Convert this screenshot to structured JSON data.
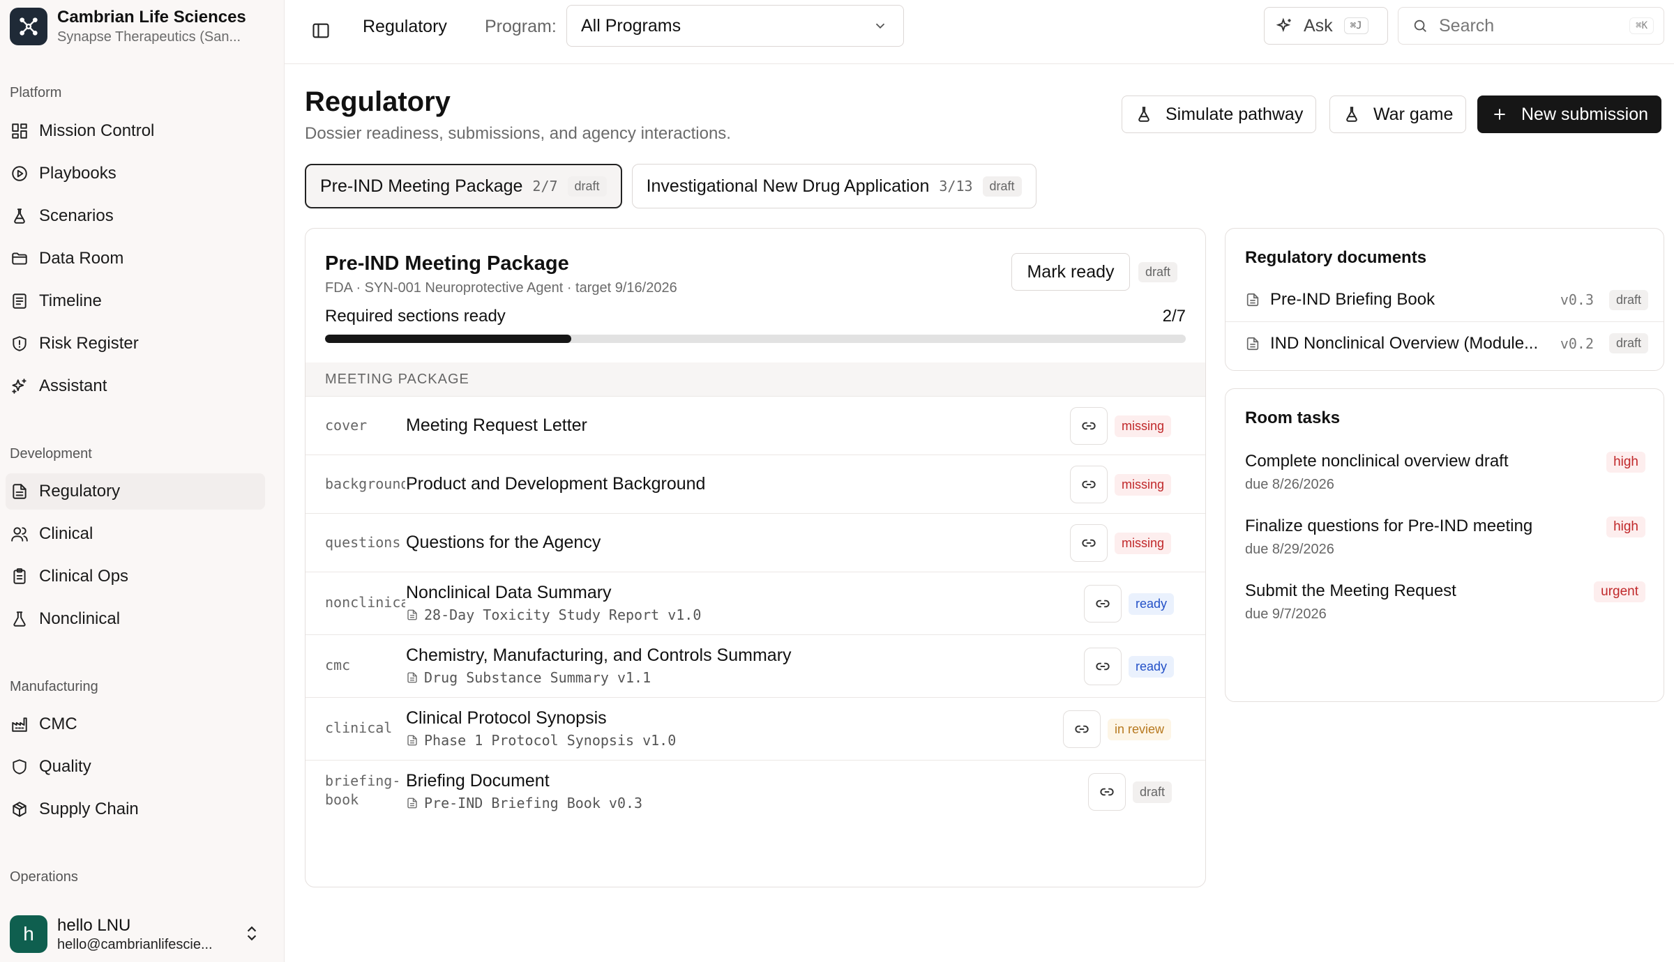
{
  "org": {
    "name": "Cambrian Life Sciences",
    "subtitle": "Synapse Therapeutics (San..."
  },
  "sidebar": {
    "sections": [
      {
        "label": "Platform"
      },
      {
        "label": "Development"
      },
      {
        "label": "Manufacturing"
      },
      {
        "label": "Operations"
      }
    ],
    "items": [
      {
        "label": "Mission Control",
        "icon": "dashboard-icon"
      },
      {
        "label": "Playbooks",
        "icon": "play-circle-icon"
      },
      {
        "label": "Scenarios",
        "icon": "flask-icon"
      },
      {
        "label": "Data Room",
        "icon": "folder-icon"
      },
      {
        "label": "Timeline",
        "icon": "list-icon"
      },
      {
        "label": "Risk Register",
        "icon": "shield-alert-icon"
      },
      {
        "label": "Assistant",
        "icon": "sparkles-icon"
      },
      {
        "label": "Regulatory",
        "icon": "file-text-icon",
        "active": true
      },
      {
        "label": "Clinical",
        "icon": "users-icon"
      },
      {
        "label": "Clinical Ops",
        "icon": "clipboard-icon"
      },
      {
        "label": "Nonclinical",
        "icon": "beaker-icon"
      },
      {
        "label": "CMC",
        "icon": "factory-icon"
      },
      {
        "label": "Quality",
        "icon": "shield-icon"
      },
      {
        "label": "Supply Chain",
        "icon": "package-icon"
      }
    ]
  },
  "user": {
    "initial": "h",
    "name": "hello LNU",
    "email": "hello@cambrianlifescie..."
  },
  "topbar": {
    "breadcrumb": "Regulatory",
    "program_label": "Program:",
    "program_value": "All Programs",
    "ask_label": "Ask",
    "ask_shortcut": "⌘J",
    "search_placeholder": "Search",
    "search_shortcut": "⌘K"
  },
  "page": {
    "title": "Regulatory",
    "subtitle": "Dossier readiness, submissions, and agency interactions.",
    "buttons": {
      "simulate": "Simulate pathway",
      "wargame": "War game",
      "new_submission": "New submission"
    }
  },
  "tabs": [
    {
      "label": "Pre-IND Meeting Package",
      "count": "2/7",
      "status": "draft",
      "active": true
    },
    {
      "label": "Investigational New Drug Application",
      "count": "3/13",
      "status": "draft"
    }
  ],
  "package": {
    "title": "Pre-IND Meeting Package",
    "meta": "FDA · SYN-001 Neuroprotective Agent · target 9/16/2026",
    "mark_ready_label": "Mark ready",
    "status": "draft",
    "progress_label": "Required sections ready",
    "progress_count": "2/7",
    "progress_fraction": 0.286,
    "section_heading": "MEETING PACKAGE",
    "rows": [
      {
        "key": "cover",
        "title": "Meeting Request Letter",
        "doc": "",
        "status": "missing"
      },
      {
        "key": "background",
        "title": "Product and Development Background",
        "doc": "",
        "status": "missing"
      },
      {
        "key": "questions",
        "title": "Questions for the Agency",
        "doc": "",
        "status": "missing"
      },
      {
        "key": "nonclinical",
        "title": "Nonclinical Data Summary",
        "doc": "28-Day Toxicity Study Report v1.0",
        "status": "ready"
      },
      {
        "key": "cmc",
        "title": "Chemistry, Manufacturing, and Controls Summary",
        "doc": "Drug Substance Summary v1.1",
        "status": "ready"
      },
      {
        "key": "clinical",
        "title": "Clinical Protocol Synopsis",
        "doc": "Phase 1 Protocol Synopsis v1.0",
        "status": "in review"
      },
      {
        "key": "briefing-book",
        "title": "Briefing Document",
        "doc": "Pre-IND Briefing Book v0.3",
        "status": "draft"
      }
    ]
  },
  "documents": {
    "title": "Regulatory documents",
    "items": [
      {
        "name": "Pre-IND Briefing Book",
        "version": "v0.3",
        "status": "draft"
      },
      {
        "name": "IND Nonclinical Overview (Module...",
        "version": "v0.2",
        "status": "draft"
      }
    ]
  },
  "tasks": {
    "title": "Room tasks",
    "items": [
      {
        "title": "Complete nonclinical overview draft",
        "due": "due 8/26/2026",
        "priority": "high"
      },
      {
        "title": "Finalize questions for Pre-IND meeting",
        "due": "due 8/29/2026",
        "priority": "high"
      },
      {
        "title": "Submit the Meeting Request",
        "due": "due 9/7/2026",
        "priority": "urgent"
      }
    ]
  },
  "colors": {
    "primary": "#161616",
    "missing": "#c0282a",
    "ready": "#2350c7",
    "review": "#b7791f",
    "avatar": "#0f5f4f"
  }
}
